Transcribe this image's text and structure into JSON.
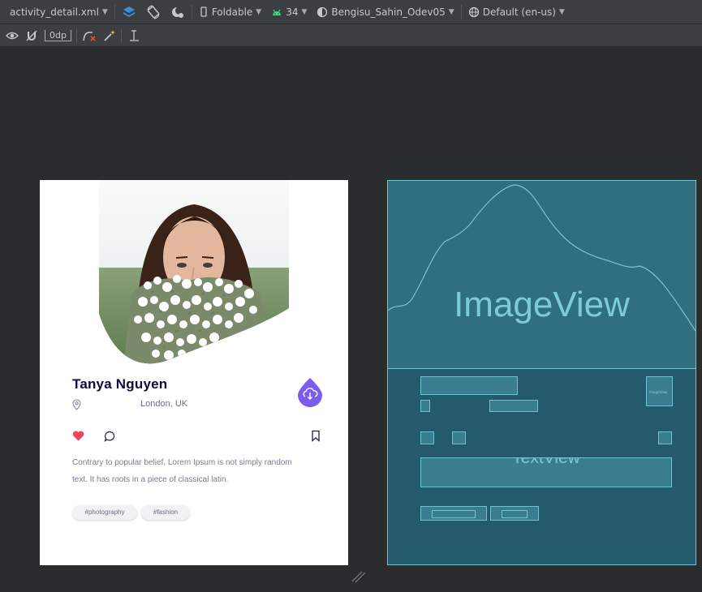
{
  "toolbar": {
    "file_name": "activity_detail.xml",
    "device": "Foldable",
    "api_level": "34",
    "theme": "Bengisu_Sahin_Odev05",
    "locale": "Default (en-us)",
    "margin_value": "0dp"
  },
  "profile": {
    "name": "Tanya Nguyen",
    "location": "London, UK",
    "description_line1": "Contrary to popular belief, Lorem Ipsum is not simply random",
    "description_line2": "text. It has roots in a piece of classical latin.",
    "tags": [
      "#photography",
      "#fashion"
    ]
  },
  "blueprint": {
    "image_label": "ImageView",
    "text_label": "TextView",
    "tiny_label": "imageView"
  },
  "colors": {
    "accent": "#7b5cf0",
    "heart": "#f04659",
    "title": "#0d0a3d",
    "blueprint_bg": "#235b6c",
    "blueprint_line": "#6fc1d4"
  }
}
